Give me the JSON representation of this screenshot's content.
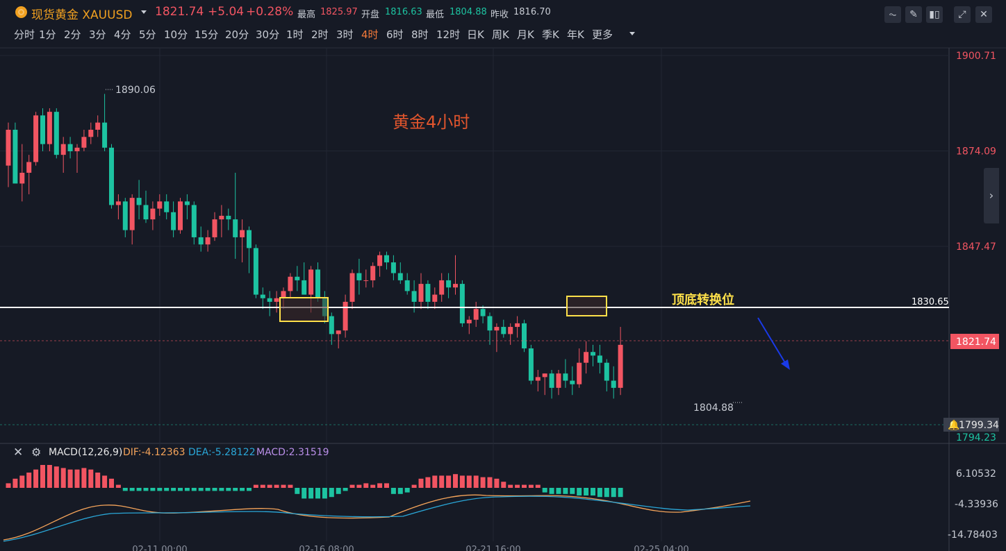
{
  "header": {
    "symbol": "现货黄金 XAUUSD",
    "last_price": "1821.74",
    "change": "+5.04",
    "change_pct": "+0.28%",
    "high_label": "最高",
    "high": "1825.97",
    "open_label": "开盘",
    "open": "1816.63",
    "low_label": "最低",
    "low": "1804.88",
    "prev_close_label": "昨收",
    "prev_close": "1816.70"
  },
  "toolbar": {
    "icons": [
      "indicator-icon",
      "draw-icon",
      "candle-type-icon",
      "fullscreen-icon",
      "close-icon"
    ]
  },
  "periods": [
    "分时",
    "1分",
    "2分",
    "3分",
    "4分",
    "5分",
    "10分",
    "15分",
    "20分",
    "30分",
    "1时",
    "2时",
    "3时",
    "4时",
    "6时",
    "8时",
    "12时",
    "日K",
    "周K",
    "月K",
    "季K",
    "年K",
    "更多"
  ],
  "active_period": "4时",
  "chart_data": {
    "type": "candlestick",
    "title": "黄金4小时",
    "y_ticks": [
      "1900.71",
      "1874.09",
      "1847.47",
      "1794.23"
    ],
    "x_ticks": [
      "02-11 00:00",
      "02-16 08:00",
      "02-21 16:00",
      "02-25 04:00"
    ],
    "high_marker": "1890.06",
    "low_marker": "1804.88",
    "level_line": {
      "value": "1830.65",
      "label": "顶底转换位"
    },
    "current_price": "1821.74",
    "alert_price": "1799.34",
    "candles": [
      [
        1870,
        1882,
        1864,
        1880
      ],
      [
        1880,
        1882,
        1872,
        1865
      ],
      [
        1865,
        1876,
        1860,
        1868
      ],
      [
        1868,
        1873,
        1862,
        1871
      ],
      [
        1871,
        1885,
        1870,
        1884
      ],
      [
        1884,
        1886,
        1874,
        1876
      ],
      [
        1876,
        1886,
        1874,
        1885
      ],
      [
        1885,
        1886,
        1872,
        1873
      ],
      [
        1873,
        1878,
        1868,
        1876
      ],
      [
        1876,
        1878,
        1872,
        1874
      ],
      [
        1874,
        1876,
        1868,
        1875
      ],
      [
        1875,
        1880,
        1874,
        1878
      ],
      [
        1878,
        1882,
        1876,
        1880
      ],
      [
        1880,
        1884,
        1878,
        1882
      ],
      [
        1882,
        1890,
        1874,
        1875
      ],
      [
        1875,
        1876,
        1858,
        1859
      ],
      [
        1859,
        1862,
        1855,
        1860
      ],
      [
        1860,
        1861,
        1850,
        1852
      ],
      [
        1852,
        1862,
        1848,
        1861
      ],
      [
        1861,
        1866,
        1855,
        1859
      ],
      [
        1859,
        1863,
        1854,
        1855
      ],
      [
        1855,
        1860,
        1852,
        1858
      ],
      [
        1858,
        1862,
        1856,
        1860
      ],
      [
        1860,
        1862,
        1855,
        1857
      ],
      [
        1857,
        1860,
        1850,
        1852
      ],
      [
        1852,
        1861,
        1851,
        1860
      ],
      [
        1860,
        1862,
        1855,
        1859
      ],
      [
        1859,
        1860,
        1848,
        1850
      ],
      [
        1850,
        1853,
        1846,
        1848
      ],
      [
        1848,
        1852,
        1846,
        1850
      ],
      [
        1850,
        1857,
        1849,
        1855
      ],
      [
        1855,
        1859,
        1850,
        1856
      ],
      [
        1856,
        1858,
        1852,
        1855
      ],
      [
        1855,
        1868,
        1844,
        1850
      ],
      [
        1850,
        1855,
        1843,
        1852
      ],
      [
        1852,
        1853,
        1840,
        1847
      ],
      [
        1847,
        1848,
        1833,
        1834
      ],
      [
        1834,
        1836,
        1830,
        1833
      ],
      [
        1833,
        1835,
        1828,
        1832
      ],
      [
        1832,
        1835,
        1829,
        1833
      ],
      [
        1833,
        1836,
        1830,
        1835
      ],
      [
        1835,
        1840,
        1833,
        1839
      ],
      [
        1839,
        1842,
        1835,
        1838
      ],
      [
        1838,
        1843,
        1834,
        1834
      ],
      [
        1834,
        1842,
        1829,
        1841
      ],
      [
        1841,
        1843,
        1832,
        1833
      ],
      [
        1833,
        1835,
        1826,
        1828
      ],
      [
        1828,
        1829,
        1820,
        1823
      ],
      [
        1823,
        1824,
        1819,
        1824
      ],
      [
        1824,
        1834,
        1822,
        1832
      ],
      [
        1832,
        1841,
        1830,
        1840
      ],
      [
        1840,
        1844,
        1834,
        1838
      ],
      [
        1838,
        1841,
        1836,
        1838
      ],
      [
        1838,
        1843,
        1836,
        1842
      ],
      [
        1842,
        1846,
        1839,
        1845
      ],
      [
        1845,
        1846,
        1841,
        1843
      ],
      [
        1843,
        1845,
        1838,
        1840
      ],
      [
        1840,
        1843,
        1837,
        1838
      ],
      [
        1838,
        1840,
        1834,
        1835
      ],
      [
        1835,
        1838,
        1829,
        1832
      ],
      [
        1832,
        1840,
        1830,
        1837
      ],
      [
        1837,
        1838,
        1830,
        1832
      ],
      [
        1832,
        1836,
        1830,
        1834
      ],
      [
        1834,
        1840,
        1832,
        1838
      ],
      [
        1838,
        1840,
        1833,
        1836
      ],
      [
        1836,
        1845,
        1834,
        1837
      ],
      [
        1837,
        1838,
        1825,
        1826
      ],
      [
        1826,
        1828,
        1823,
        1827
      ],
      [
        1827,
        1832,
        1825,
        1830
      ],
      [
        1830,
        1831,
        1826,
        1828
      ],
      [
        1828,
        1829,
        1820,
        1824
      ],
      [
        1824,
        1826,
        1818,
        1825
      ],
      [
        1825,
        1827,
        1822,
        1823
      ],
      [
        1823,
        1826,
        1820,
        1825
      ],
      [
        1825,
        1828,
        1822,
        1826
      ],
      [
        1826,
        1827,
        1818,
        1819
      ],
      [
        1819,
        1820,
        1809,
        1810
      ],
      [
        1810,
        1813,
        1807,
        1811
      ],
      [
        1811,
        1812,
        1806,
        1812
      ],
      [
        1812,
        1813,
        1805,
        1808
      ],
      [
        1808,
        1813,
        1806,
        1812
      ],
      [
        1812,
        1816,
        1808,
        1810
      ],
      [
        1810,
        1814,
        1806,
        1809
      ],
      [
        1809,
        1819,
        1808,
        1815
      ],
      [
        1815,
        1821,
        1812,
        1818
      ],
      [
        1818,
        1820,
        1814,
        1817
      ],
      [
        1817,
        1820,
        1812,
        1815
      ],
      [
        1815,
        1816,
        1807,
        1810
      ],
      [
        1810,
        1814,
        1805,
        1808
      ],
      [
        1808,
        1825,
        1806,
        1820
      ]
    ],
    "macd": {
      "label": "MACD(12,26,9)",
      "dif_label": "DIF:-4.12363",
      "dea_label": "DEA:-5.28122",
      "macd_label": "MACD:2.31519",
      "y_ticks": [
        "6.10532",
        "-4.33936",
        "-14.78403"
      ]
    }
  },
  "colors": {
    "up": "#f25562",
    "down": "#1dc3a1",
    "bg": "#161a25",
    "accent": "#f47a3a"
  }
}
